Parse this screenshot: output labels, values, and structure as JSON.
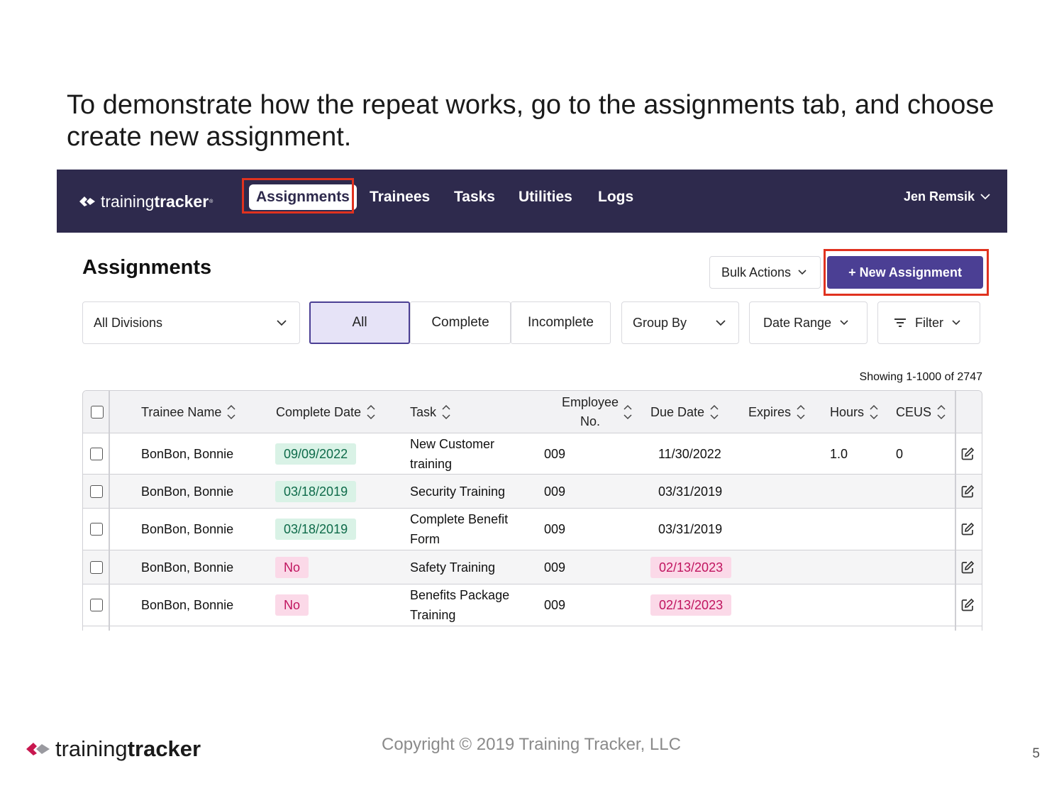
{
  "slide": {
    "heading": "To demonstrate how the repeat works, go to the assignments tab, and choose create new assignment.",
    "copyright": "Copyright © 2019 Training Tracker, LLC",
    "page_number": "5",
    "footer_logo": {
      "light": "training",
      "bold": "tracker"
    }
  },
  "nav": {
    "logo": {
      "light": "training",
      "bold": "tracker",
      "mark": "®"
    },
    "tabs": [
      {
        "label": "Assignments",
        "active": true
      },
      {
        "label": "Trainees"
      },
      {
        "label": "Tasks"
      },
      {
        "label": "Utilities"
      },
      {
        "label": "Logs"
      }
    ],
    "user": "Jen Remsik"
  },
  "page": {
    "title": "Assignments",
    "bulk_actions": "Bulk Actions",
    "new_assignment": "+ New Assignment",
    "division_select": "All Divisions",
    "status_filters": [
      "All",
      "Complete",
      "Incomplete"
    ],
    "active_status": "All",
    "group_by": "Group By",
    "date_range": "Date Range",
    "filter": "Filter",
    "showing": "Showing 1-1000 of 2747"
  },
  "table": {
    "columns": {
      "trainee": "Trainee Name",
      "complete_date": "Complete Date",
      "task": "Task",
      "employee_line1": "Employee",
      "employee_line2": "No.",
      "due_date": "Due Date",
      "expires": "Expires",
      "hours": "Hours",
      "ceus": "CEUS"
    },
    "rows": [
      {
        "trainee": "BonBon, Bonnie",
        "complete": "09/09/2022",
        "complete_status": "done",
        "task1": "New Customer",
        "task2": "training",
        "emp": "009",
        "due": "11/30/2022",
        "due_overdue": false,
        "expires": "",
        "hours": "1.0",
        "ceus": "0"
      },
      {
        "trainee": "BonBon, Bonnie",
        "complete": "03/18/2019",
        "complete_status": "done",
        "task1": "Security Training",
        "task2": "",
        "emp": "009",
        "due": "03/31/2019",
        "due_overdue": false,
        "expires": "",
        "hours": "",
        "ceus": ""
      },
      {
        "trainee": "BonBon, Bonnie",
        "complete": "03/18/2019",
        "complete_status": "done",
        "task1": "Complete Benefit",
        "task2": "Form",
        "emp": "009",
        "due": "03/31/2019",
        "due_overdue": false,
        "expires": "",
        "hours": "",
        "ceus": ""
      },
      {
        "trainee": "BonBon, Bonnie",
        "complete": "No",
        "complete_status": "no",
        "task1": "Safety Training",
        "task2": "",
        "emp": "009",
        "due": "02/13/2023",
        "due_overdue": true,
        "expires": "",
        "hours": "",
        "ceus": ""
      },
      {
        "trainee": "BonBon, Bonnie",
        "complete": "No",
        "complete_status": "no",
        "task1": "Benefits Package",
        "task2": "Training",
        "emp": "009",
        "due": "02/13/2023",
        "due_overdue": true,
        "expires": "",
        "hours": "",
        "ceus": ""
      }
    ]
  },
  "colors": {
    "nav_bg": "#2e2a4d",
    "primary": "#4b3f94",
    "highlight": "#e0321f",
    "complete_bg": "#d9f2e6",
    "overdue_bg": "#fbd9e8",
    "logo_pink": "#c8174f"
  }
}
